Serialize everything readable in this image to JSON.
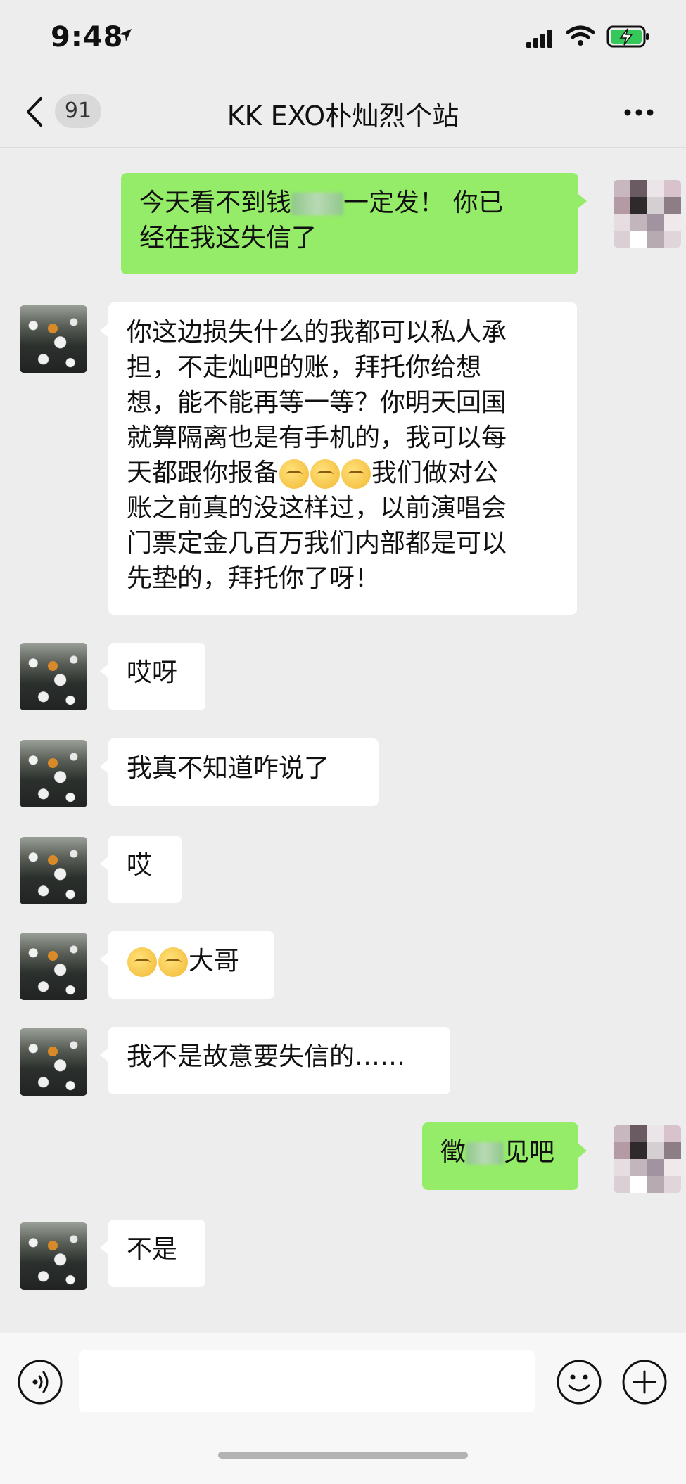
{
  "status": {
    "time": "9:48"
  },
  "nav": {
    "badge": "91",
    "title": "KK EXO朴灿烈个站"
  },
  "messages": {
    "m1_a": "今天看不到钱",
    "m1_b": "一定发！ 你已",
    "m1_c": "经在我这失信了",
    "m2_l1": "你这边损失什么的我都可以私人承",
    "m2_l2": "担，不走灿吧的账，拜托你给想",
    "m2_l3": "想，能不能再等一等？你明天回国",
    "m2_l4": "就算隔离也是有手机的，我可以每",
    "m2_l5a": "天都跟你报备",
    "m2_l5b": "我们做对公",
    "m2_l6": "账之前真的没这样过，以前演唱会",
    "m2_l7": "门票定金几百万我们内部都是可以",
    "m2_l8": "先垫的，拜托你了呀！",
    "m3": "哎呀",
    "m4": "我真不知道咋说了",
    "m5": "哎",
    "m6": "大哥",
    "m7": "我不是故意要失信的……",
    "m8_a": "徵",
    "m8_b": "见吧",
    "m9": "不是"
  },
  "icons": {
    "back": "chevron-left-icon",
    "more": "more-dots-icon",
    "voice": "voice-input-icon",
    "emoji": "emoji-icon",
    "plus": "add-icon"
  },
  "colors": {
    "outgoing": "#95ec69",
    "incoming": "#ffffff",
    "background": "#ededed"
  }
}
